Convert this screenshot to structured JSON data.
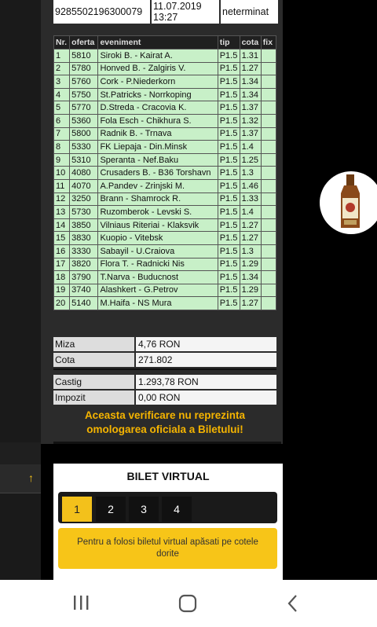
{
  "ticket": {
    "id": "9285502196300079",
    "date": "11.07.2019",
    "time": "13:27",
    "status": "neterminat"
  },
  "columns": [
    "Nr.",
    "oferta",
    "eveniment",
    "tip",
    "cota",
    "fix"
  ],
  "bets": [
    {
      "nr": "1",
      "oferta": "5810",
      "eveniment": "Siroki B. - Kairat A.",
      "tip": "P1.5",
      "cota": "1.31",
      "fix": ""
    },
    {
      "nr": "2",
      "oferta": "5780",
      "eveniment": "Honved B. - Zalgiris V.",
      "tip": "P1.5",
      "cota": "1.27",
      "fix": ""
    },
    {
      "nr": "3",
      "oferta": "5760",
      "eveniment": "Cork - P.Niederkorn",
      "tip": "P1.5",
      "cota": "1.34",
      "fix": ""
    },
    {
      "nr": "4",
      "oferta": "5750",
      "eveniment": "St.Patricks - Norrkoping",
      "tip": "P1.5",
      "cota": "1.34",
      "fix": ""
    },
    {
      "nr": "5",
      "oferta": "5770",
      "eveniment": "D.Streda - Cracovia K.",
      "tip": "P1.5",
      "cota": "1.37",
      "fix": ""
    },
    {
      "nr": "6",
      "oferta": "5360",
      "eveniment": "Fola Esch - Chikhura S.",
      "tip": "P1.5",
      "cota": "1.32",
      "fix": ""
    },
    {
      "nr": "7",
      "oferta": "5800",
      "eveniment": "Radnik B. - Trnava",
      "tip": "P1.5",
      "cota": "1.37",
      "fix": ""
    },
    {
      "nr": "8",
      "oferta": "5330",
      "eveniment": "FK Liepaja - Din.Minsk",
      "tip": "P1.5",
      "cota": "1.4",
      "fix": ""
    },
    {
      "nr": "9",
      "oferta": "5310",
      "eveniment": "Speranta - Nef.Baku",
      "tip": "P1.5",
      "cota": "1.25",
      "fix": ""
    },
    {
      "nr": "10",
      "oferta": "4080",
      "eveniment": "Crusaders B. - B36 Torshavn",
      "tip": "P1.5",
      "cota": "1.3",
      "fix": ""
    },
    {
      "nr": "11",
      "oferta": "4070",
      "eveniment": "A.Pandev - Zrinjski M.",
      "tip": "P1.5",
      "cota": "1.46",
      "fix": ""
    },
    {
      "nr": "12",
      "oferta": "3250",
      "eveniment": "Brann - Shamrock R.",
      "tip": "P1.5",
      "cota": "1.33",
      "fix": ""
    },
    {
      "nr": "13",
      "oferta": "5730",
      "eveniment": "Ruzomberok - Levski S.",
      "tip": "P1.5",
      "cota": "1.4",
      "fix": ""
    },
    {
      "nr": "14",
      "oferta": "3850",
      "eveniment": "Vilniaus Riteriai - Klaksvik",
      "tip": "P1.5",
      "cota": "1.27",
      "fix": ""
    },
    {
      "nr": "15",
      "oferta": "3830",
      "eveniment": "Kuopio - Vitebsk",
      "tip": "P1.5",
      "cota": "1.27",
      "fix": ""
    },
    {
      "nr": "16",
      "oferta": "3330",
      "eveniment": "Sabayil - U.Craiova",
      "tip": "P1.5",
      "cota": "1.3",
      "fix": ""
    },
    {
      "nr": "17",
      "oferta": "3820",
      "eveniment": "Flora T. - Radnicki Nis",
      "tip": "P1.5",
      "cota": "1.29",
      "fix": ""
    },
    {
      "nr": "18",
      "oferta": "3790",
      "eveniment": "T.Narva - Buducnost",
      "tip": "P1.5",
      "cota": "1.34",
      "fix": ""
    },
    {
      "nr": "19",
      "oferta": "3740",
      "eveniment": "Alashkert - G.Petrov",
      "tip": "P1.5",
      "cota": "1.29",
      "fix": ""
    },
    {
      "nr": "20",
      "oferta": "5140",
      "eveniment": "M.Haifa - NS Mura",
      "tip": "P1.5",
      "cota": "1.27",
      "fix": ""
    }
  ],
  "summary": {
    "miza_label": "Miza",
    "miza": "4,76 RON",
    "cota_label": "Cota",
    "cota": "271.802",
    "castig_label": "Castig",
    "castig": "1.293,78 RON",
    "impozit_label": "Impozit",
    "impozit": "0,00 RON"
  },
  "notice": "Aceasta verificare nu reprezinta omologarea oficiala a Biletului!",
  "virtual": {
    "title": "BILET VIRTUAL",
    "tabs": [
      "1",
      "2",
      "3",
      "4"
    ],
    "active_tab": "1",
    "hint": "Pentru a folosi biletul virtual apăsati pe cotele dorite"
  },
  "side": {
    "arrow": "↑"
  },
  "icons": {
    "ad": "bottle-ad-icon",
    "nav_recent": "recent-apps-icon",
    "nav_home": "home-icon",
    "nav_back": "back-icon"
  },
  "colors": {
    "row": "#c8f0c8",
    "accent": "#f3c11b",
    "panel": "#2b2b2b"
  }
}
